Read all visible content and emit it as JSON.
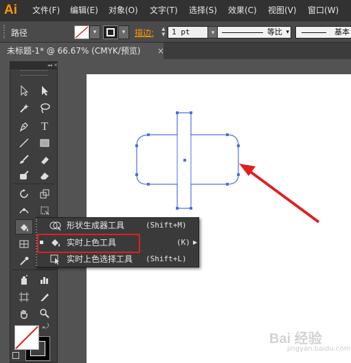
{
  "app": {
    "logo": "Ai"
  },
  "menubar": {
    "items": [
      "文件(F)",
      "编辑(E)",
      "对象(O)",
      "文字(T)",
      "选择(S)",
      "效果(C)",
      "视图(V)",
      "窗口(W)"
    ]
  },
  "controlbar": {
    "path_label": "路径",
    "stroke_label": "描边:",
    "stroke_weight": "1 pt",
    "stroke_profile": "等比",
    "brush": "基本"
  },
  "document": {
    "tab_title": "未标题-1* @ 66.67% (CMYK/预览)",
    "close_glyph": "×"
  },
  "toolspanel": {
    "header": "◂◂ ✕"
  },
  "flyout": {
    "items": [
      {
        "name": "形状生成器工具",
        "shortcut": "(Shift+M)",
        "selected": false,
        "has_submenu": false
      },
      {
        "name": "实时上色工具",
        "shortcut": "(K)",
        "selected": true,
        "has_submenu": true
      },
      {
        "name": "实时上色选择工具",
        "shortcut": "(Shift+L)",
        "selected": false,
        "has_submenu": false
      }
    ]
  },
  "colors": {
    "accent": "#ff9a00",
    "selection": "#4a6fdc",
    "annotation": "#e02020"
  },
  "watermark": {
    "text": "Bai 经验",
    "sub": "jingyan.baidu.com"
  }
}
